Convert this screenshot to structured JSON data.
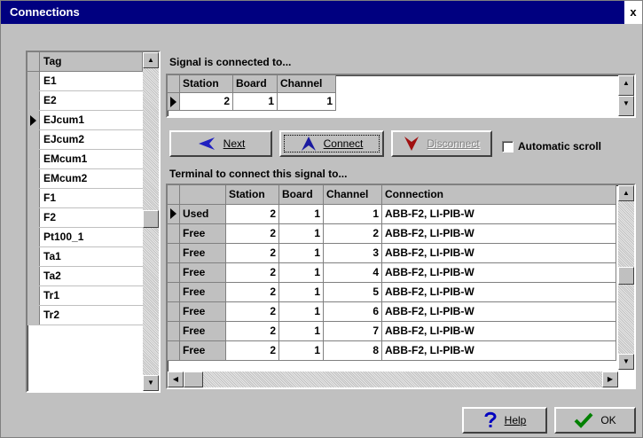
{
  "window": {
    "title": "Connections",
    "close_glyph": "x"
  },
  "tag_list": {
    "header": "Tag",
    "items": [
      "E1",
      "E2",
      "EJcum1",
      "EJcum2",
      "EMcum1",
      "EMcum2",
      "F1",
      "F2",
      "Pt100_1",
      "Ta1",
      "Ta2",
      "Tr1",
      "Tr2"
    ],
    "selected_index": 2
  },
  "signal_section": {
    "label": "Signal is connected to...",
    "columns": [
      "Station",
      "Board",
      "Channel"
    ],
    "rows": [
      {
        "station": "2",
        "board": "1",
        "channel": "1"
      }
    ]
  },
  "buttons": {
    "next": "Next",
    "connect": "Connect",
    "disconnect": "Disconnect",
    "help": "Help",
    "ok": "OK"
  },
  "automatic_scroll": {
    "label": "Automatic scroll",
    "checked": false
  },
  "terminal_section": {
    "label": "Terminal to connect this signal to...",
    "columns": [
      "",
      "Station",
      "Board",
      "Channel",
      "Connection"
    ],
    "rows": [
      {
        "status": "Used",
        "station": "2",
        "board": "1",
        "channel": "1",
        "connection": "ABB-F2, LI-PIB-W"
      },
      {
        "status": "Free",
        "station": "2",
        "board": "1",
        "channel": "2",
        "connection": "ABB-F2, LI-PIB-W"
      },
      {
        "status": "Free",
        "station": "2",
        "board": "1",
        "channel": "3",
        "connection": "ABB-F2, LI-PIB-W"
      },
      {
        "status": "Free",
        "station": "2",
        "board": "1",
        "channel": "4",
        "connection": "ABB-F2, LI-PIB-W"
      },
      {
        "status": "Free",
        "station": "2",
        "board": "1",
        "channel": "5",
        "connection": "ABB-F2, LI-PIB-W"
      },
      {
        "status": "Free",
        "station": "2",
        "board": "1",
        "channel": "6",
        "connection": "ABB-F2, LI-PIB-W"
      },
      {
        "status": "Free",
        "station": "2",
        "board": "1",
        "channel": "7",
        "connection": "ABB-F2, LI-PIB-W"
      },
      {
        "status": "Free",
        "station": "2",
        "board": "1",
        "channel": "8",
        "connection": "ABB-F2, LI-PIB-W"
      }
    ]
  },
  "colors": {
    "title_bar": "#000080",
    "face": "#c0c0c0",
    "next_arrow": "#2020c0",
    "connect_arrow": "#1a1aa0",
    "disconnect_arrow": "#a01010",
    "help_icon": "#0000c0",
    "ok_check": "#008000"
  },
  "icons": {
    "next": "left-arrow-icon",
    "connect": "connect-arrow-icon",
    "disconnect": "disconnect-arrow-icon",
    "help": "question-mark-icon",
    "ok": "checkmark-icon"
  }
}
